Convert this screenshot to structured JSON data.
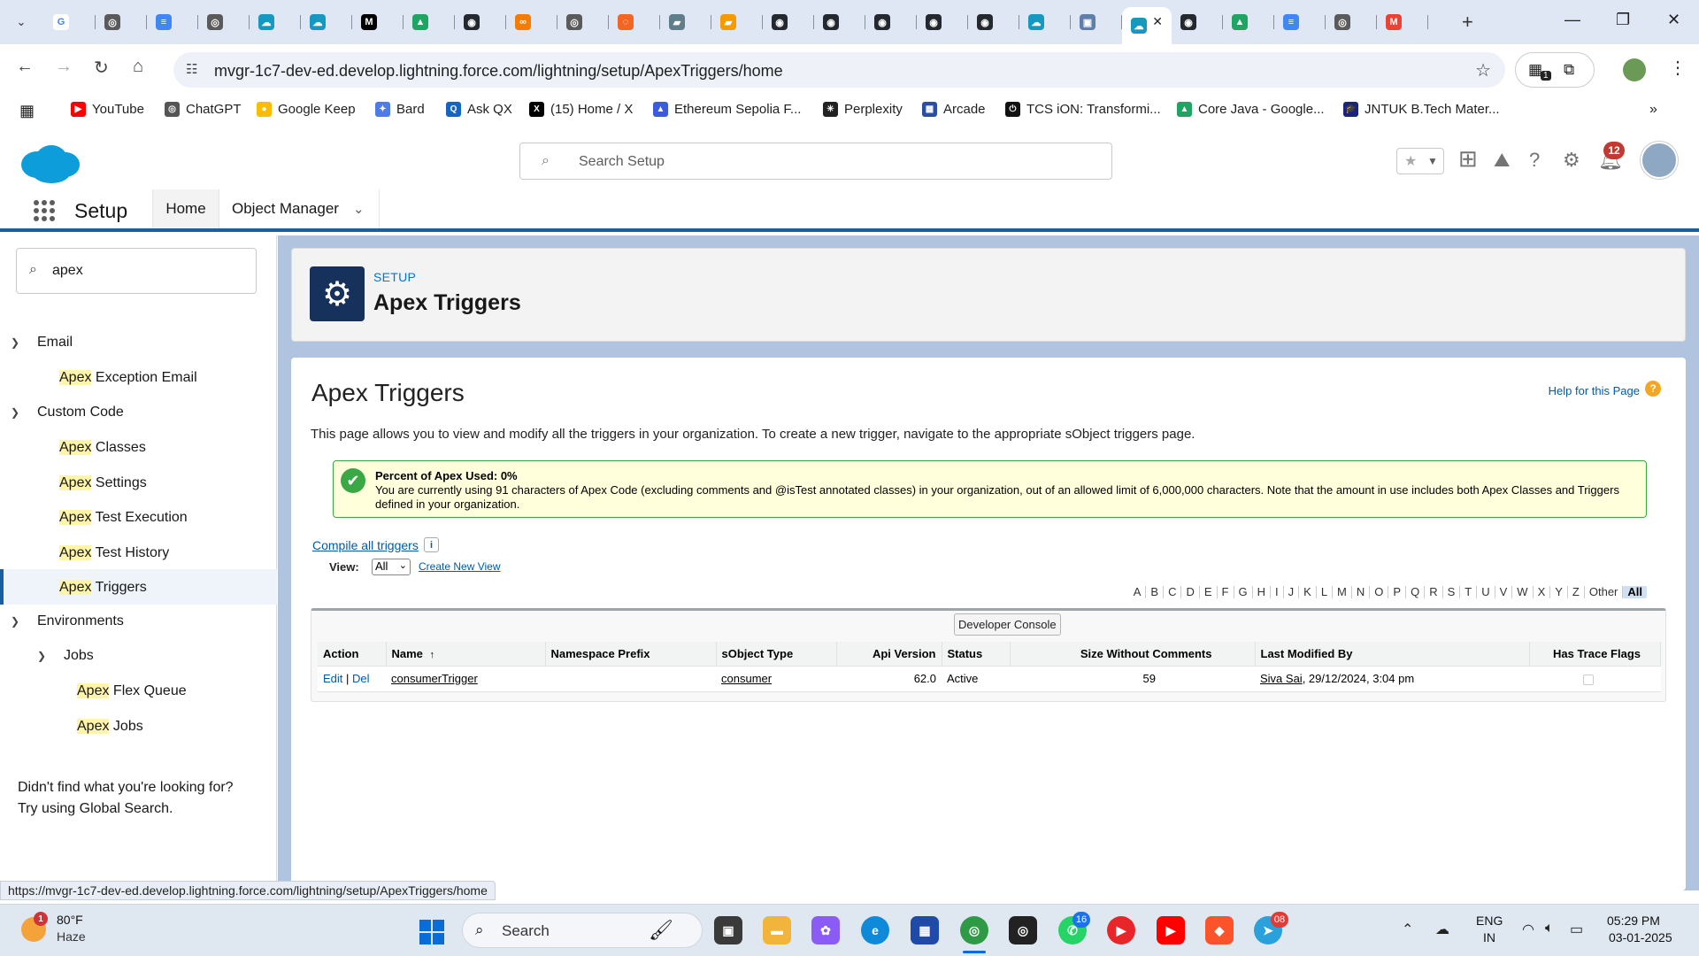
{
  "browser": {
    "tabs": [
      {
        "icon": "google-icon",
        "color": "#ffffff",
        "glyph": "G",
        "fg": "#4285f4"
      },
      {
        "icon": "chatgpt-icon",
        "color": "#5a5a5a",
        "glyph": "◎"
      },
      {
        "icon": "docs-icon",
        "color": "#4285f4",
        "glyph": "≡"
      },
      {
        "icon": "chatgpt-icon",
        "color": "#5a5a5a",
        "glyph": "◎"
      },
      {
        "icon": "salesforce-icon",
        "color": "#1798c1",
        "glyph": "☁"
      },
      {
        "icon": "salesforce-icon",
        "color": "#1798c1",
        "glyph": "☁"
      },
      {
        "icon": "medium-icon",
        "color": "#000000",
        "glyph": "M"
      },
      {
        "icon": "drive-icon",
        "color": "#1fa463",
        "glyph": "▲"
      },
      {
        "icon": "github-icon",
        "color": "#24292f",
        "glyph": "◉"
      },
      {
        "icon": "coursera-icon",
        "color": "#f57c00",
        "glyph": "∞"
      },
      {
        "icon": "chatgpt-icon",
        "color": "#5a5a5a",
        "glyph": "◎"
      },
      {
        "icon": "spinner-icon",
        "color": "#f26522",
        "glyph": "◌"
      },
      {
        "icon": "notebook-icon",
        "color": "#607d8b",
        "glyph": "▰"
      },
      {
        "icon": "notebook-icon",
        "color": "#f59b00",
        "glyph": "▰"
      },
      {
        "icon": "github-icon",
        "color": "#24292f",
        "glyph": "◉"
      },
      {
        "icon": "github-icon",
        "color": "#24292f",
        "glyph": "◉"
      },
      {
        "icon": "github-icon",
        "color": "#24292f",
        "glyph": "◉"
      },
      {
        "icon": "github-icon",
        "color": "#24292f",
        "glyph": "◉"
      },
      {
        "icon": "github-icon",
        "color": "#24292f",
        "glyph": "◉"
      },
      {
        "icon": "salesforce-icon",
        "color": "#1798c1",
        "glyph": "☁"
      },
      {
        "icon": "image-icon",
        "color": "#5f7fa8",
        "glyph": "▣"
      },
      {
        "icon": "salesforce-active-icon",
        "color": "#1798c1",
        "glyph": "☁",
        "active": true
      },
      {
        "icon": "github-icon",
        "color": "#24292f",
        "glyph": "◉"
      },
      {
        "icon": "drive-icon",
        "color": "#1fa463",
        "glyph": "▲"
      },
      {
        "icon": "docs-icon",
        "color": "#4285f4",
        "glyph": "≡"
      },
      {
        "icon": "chatgpt-icon",
        "color": "#5a5a5a",
        "glyph": "◎"
      },
      {
        "icon": "gmail-icon",
        "color": "#ea4335",
        "glyph": "M"
      }
    ],
    "url": "mvgr-1c7-dev-ed.develop.lightning.force.com/lightning/setup/ApexTriggers/home",
    "ext_badge": "1",
    "bookmarks": [
      {
        "label": "YouTube",
        "icon": "youtube-icon",
        "color": "#ff0000",
        "glyph": "▶"
      },
      {
        "label": "ChatGPT",
        "icon": "chatgpt-icon",
        "color": "#555555",
        "glyph": "◎"
      },
      {
        "label": "Google Keep",
        "icon": "keep-icon",
        "color": "#fbbc04",
        "glyph": "●"
      },
      {
        "label": "Bard",
        "icon": "bard-icon",
        "color": "#4f7be8",
        "glyph": "✦"
      },
      {
        "label": "Ask QX",
        "icon": "askqx-icon",
        "color": "#1565c0",
        "glyph": "Q"
      },
      {
        "label": "(15) Home / X",
        "icon": "x-icon",
        "color": "#000000",
        "glyph": "X"
      },
      {
        "label": "Ethereum Sepolia F...",
        "icon": "ethereum-icon",
        "color": "#3b5bdb",
        "glyph": "▲"
      },
      {
        "label": "Perplexity",
        "icon": "perplexity-icon",
        "color": "#222222",
        "glyph": "✳"
      },
      {
        "label": "Arcade",
        "icon": "arcade-icon",
        "color": "#2b4ea2",
        "glyph": "▦"
      },
      {
        "label": "TCS iON: Transformi...",
        "icon": "tcs-icon",
        "color": "#111111",
        "glyph": "⏻"
      },
      {
        "label": "Core Java - Google...",
        "icon": "drive-icon",
        "color": "#1fa463",
        "glyph": "▲"
      },
      {
        "label": "JNTUK B.Tech Mater...",
        "icon": "graduation-icon",
        "color": "#1a237e",
        "glyph": "🎓"
      }
    ]
  },
  "sf": {
    "search_placeholder": "Search Setup",
    "notif_count": "12",
    "app_name": "Setup",
    "nav": {
      "home": "Home",
      "object_manager": "Object Manager"
    }
  },
  "sidebar": {
    "quickfind_value": "apex",
    "email": "Email",
    "apex_exception_hl": "Apex",
    "apex_exception_rest": " Exception Email",
    "custom_code": "Custom Code",
    "items_custom": [
      {
        "hl": "Apex",
        "rest": " Classes"
      },
      {
        "hl": "Apex",
        "rest": " Settings"
      },
      {
        "hl": "Apex",
        "rest": " Test Execution"
      },
      {
        "hl": "Apex",
        "rest": " Test History"
      },
      {
        "hl": "Apex",
        "rest": " Triggers"
      }
    ],
    "environments": "Environments",
    "jobs": "Jobs",
    "items_jobs": [
      {
        "hl": "Apex",
        "rest": " Flex Queue"
      },
      {
        "hl": "Apex",
        "rest": " Jobs"
      }
    ],
    "help_line1": "Didn't find what you're looking for?",
    "help_line2": "Try using Global Search."
  },
  "header": {
    "crumb": "SETUP",
    "title": "Apex Triggers"
  },
  "content": {
    "title": "Apex Triggers",
    "help_link": "Help for this Page",
    "description": "This page allows you to view and modify all the triggers in your organization. To create a new trigger, navigate to the appropriate sObject triggers page.",
    "msg_title": "Percent of Apex Used: 0%",
    "msg_body": "You are currently using 91 characters of Apex Code (excluding comments and @isTest annotated classes) in your organization, out of an allowed limit of 6,000,000 characters. Note that the amount in use includes both Apex Classes and Triggers defined in your organization.",
    "compile_link": "Compile all triggers",
    "view_label": "View:",
    "view_value": "All",
    "create_view": "Create New View",
    "alphabet": [
      "A",
      "B",
      "C",
      "D",
      "E",
      "F",
      "G",
      "H",
      "I",
      "J",
      "K",
      "L",
      "M",
      "N",
      "O",
      "P",
      "Q",
      "R",
      "S",
      "T",
      "U",
      "V",
      "W",
      "X",
      "Y",
      "Z",
      "Other",
      "All"
    ],
    "dev_console": "Developer Console",
    "columns": {
      "action": "Action",
      "name": "Name",
      "sort_indicator": "↑",
      "namespace": "Namespace Prefix",
      "sobject": "sObject Type",
      "api": "Api Version",
      "status": "Status",
      "size": "Size Without Comments",
      "modified": "Last Modified By",
      "trace": "Has Trace Flags"
    },
    "rows": [
      {
        "edit": "Edit",
        "del": "Del",
        "name": "consumerTrigger",
        "namespace": "",
        "sobject": "consumer",
        "api": "62.0",
        "status": "Active",
        "size": "59",
        "modified_user": "Siva Sai",
        "modified_date": ", 29/12/2024, 3:04 pm"
      }
    ]
  },
  "statusbar": "https://mvgr-1c7-dev-ed.develop.lightning.force.com/lightning/setup/ApexTriggers/home",
  "taskbar": {
    "temp": "80°F",
    "condition": "Haze",
    "weather_badge": "1",
    "search": "Search",
    "whatsapp_badge": "16",
    "telegram_badge": "08",
    "lang1": "ENG",
    "lang2": "IN",
    "time": "05:29 PM",
    "date": "03-01-2025"
  }
}
